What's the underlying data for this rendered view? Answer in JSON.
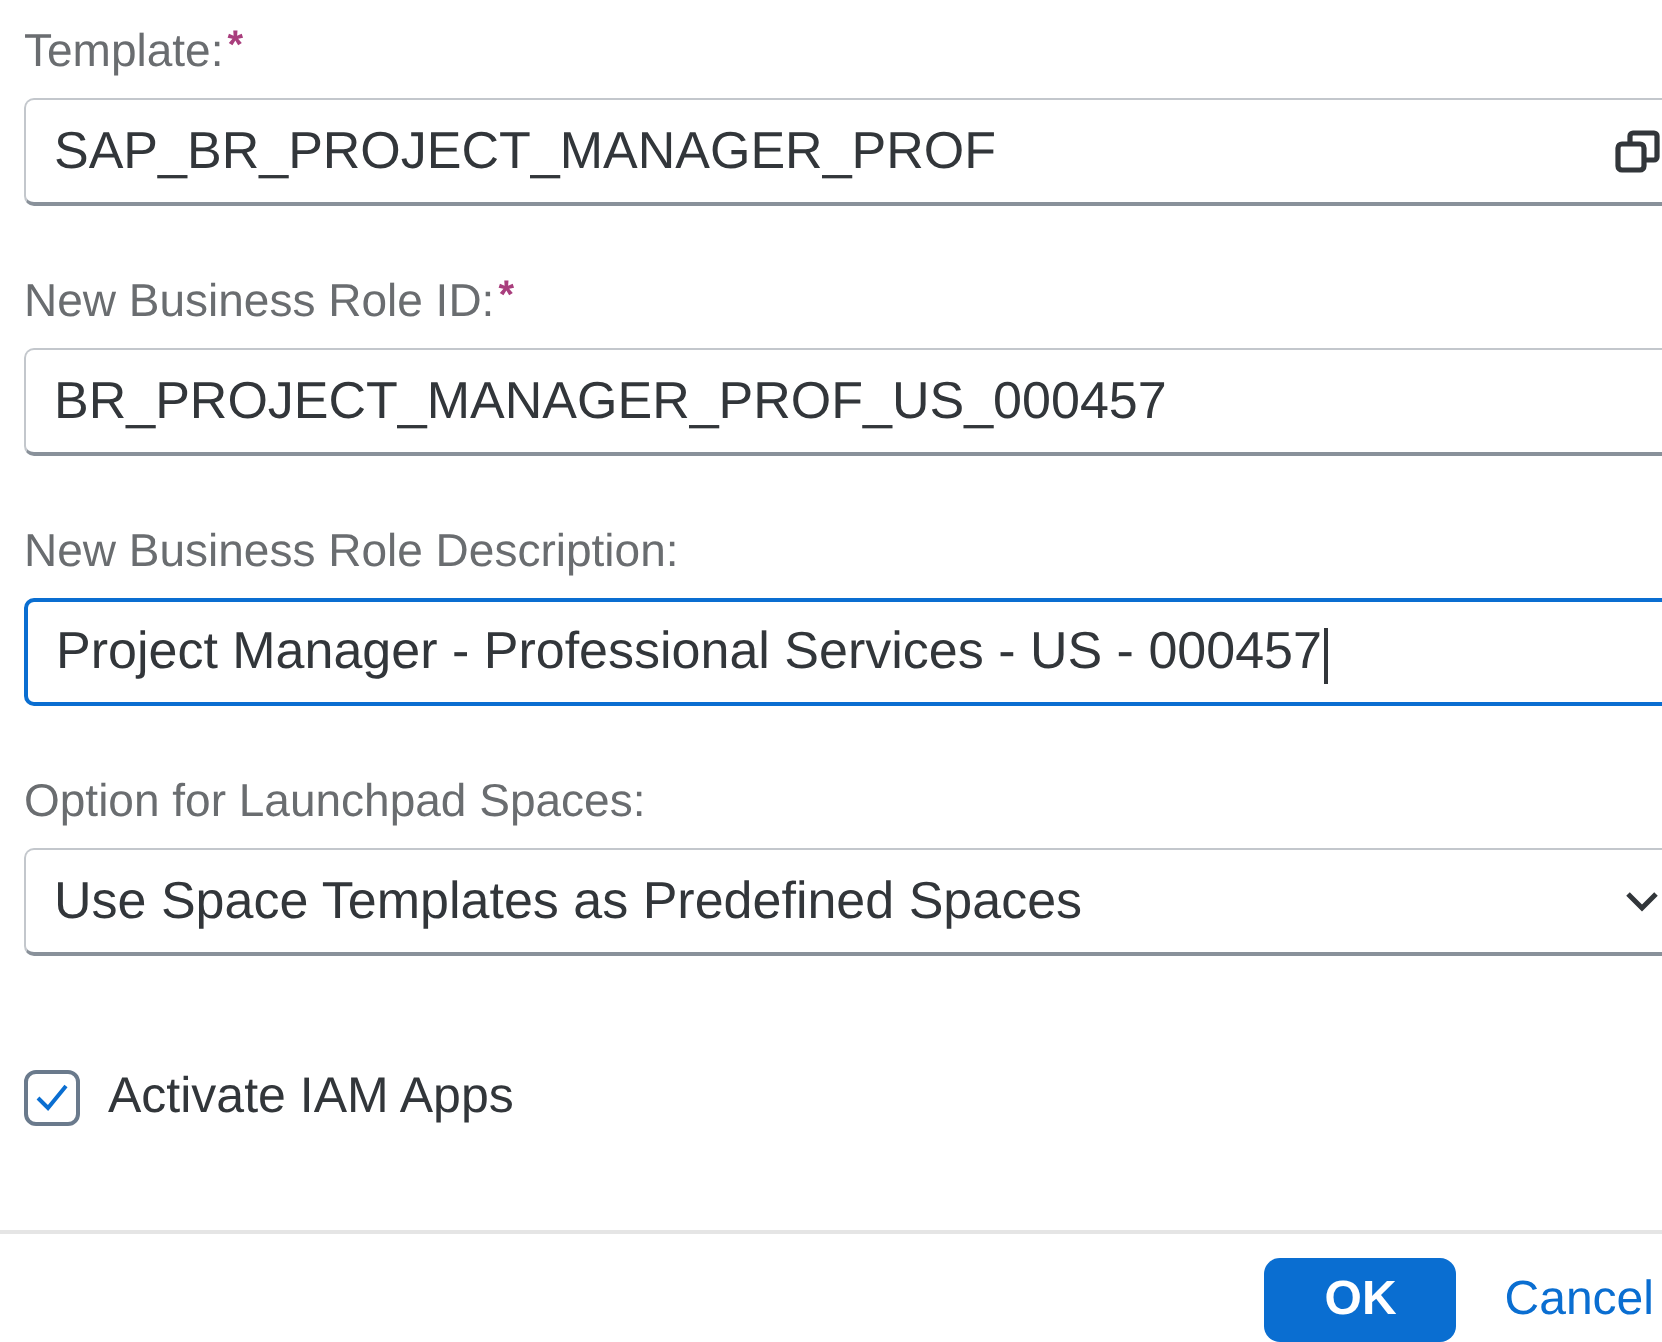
{
  "fields": [
    {
      "kind": "value-help",
      "label": "Template:",
      "required_mark": "*",
      "value": "SAP_BR_PROJECT_MANAGER_PROF",
      "focused": false
    },
    {
      "kind": "input",
      "label": "New Business Role ID:",
      "required_mark": "*",
      "value": "BR_PROJECT_MANAGER_PROF_US_000457",
      "focused": false
    },
    {
      "kind": "input",
      "label": "New Business Role Description:",
      "value": "Project Manager - Professional Services - US - 000457",
      "focused": true
    },
    {
      "kind": "select",
      "label": "Option for Launchpad Spaces:",
      "value": "Use Space Templates as Predefined Spaces",
      "focused": false
    }
  ],
  "checkbox": {
    "label": "Activate IAM Apps",
    "checked": true
  },
  "buttons": [
    {
      "label": "OK",
      "kind": "emphasized"
    },
    {
      "label": "Cancel",
      "kind": "transparent"
    }
  ]
}
